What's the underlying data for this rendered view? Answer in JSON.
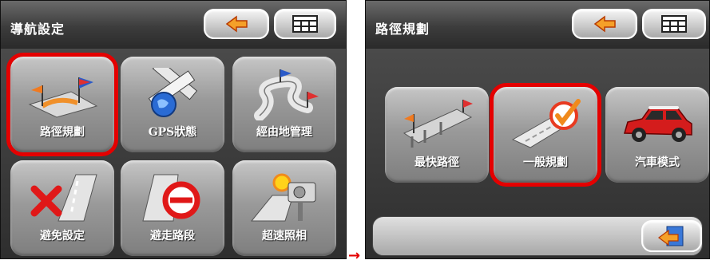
{
  "screen1": {
    "title": "導航設定",
    "tiles": [
      {
        "label": "路徑規劃",
        "icon": "route-planning-icon",
        "selected": true
      },
      {
        "label": "GPS狀態",
        "icon": "gps-satellite-icon",
        "selected": false
      },
      {
        "label": "經由地管理",
        "icon": "waypoint-management-icon",
        "selected": false
      },
      {
        "label": "避免設定",
        "icon": "avoid-settings-icon",
        "selected": false
      },
      {
        "label": "避走路段",
        "icon": "avoid-road-section-icon",
        "selected": false
      },
      {
        "label": "超速照相",
        "icon": "speed-camera-icon",
        "selected": false
      }
    ]
  },
  "screen2": {
    "title": "路徑規劃",
    "tiles": [
      {
        "label": "最快路徑",
        "icon": "fastest-route-icon",
        "selected": false
      },
      {
        "label": "一般規劃",
        "icon": "normal-planning-icon",
        "selected": true
      },
      {
        "label": "汽車模式",
        "icon": "car-mode-icon",
        "selected": false
      }
    ],
    "bottom_bar_icon": "return-icon"
  },
  "transition_arrow": "→",
  "colors": {
    "highlight": "#e40000",
    "back_arrow": "#f08a1c",
    "arrow_outline": "#b83a00"
  }
}
